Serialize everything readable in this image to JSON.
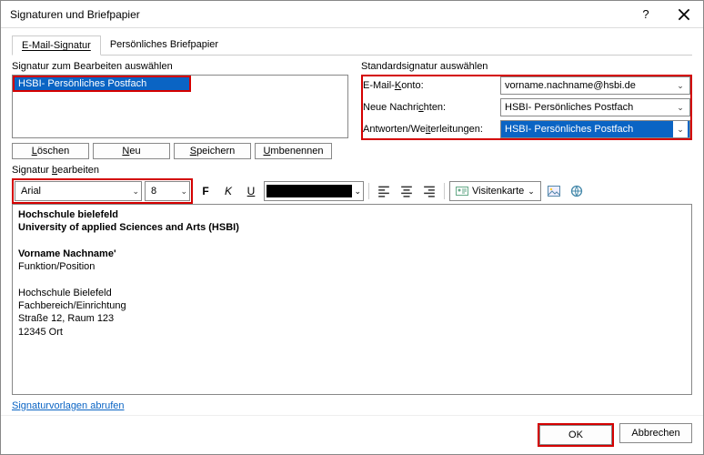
{
  "titlebar": {
    "title": "Signaturen und Briefpapier"
  },
  "tabs": {
    "t1": "E-Mail-Signatur",
    "t2": "Persönliches Briefpapier"
  },
  "left": {
    "label": "Signatur zum Bearbeiten auswählen",
    "item": "HSBI- Persönliches Postfach",
    "btn_delete": "Löschen",
    "btn_new": "Neu",
    "btn_save": "Speichern",
    "btn_rename": "Umbenennen"
  },
  "right": {
    "label": "Standardsignatur auswählen",
    "l_account": "E-Mail-Konto:",
    "v_account": "vorname.nachname@hsbi.de",
    "l_new": "Neue Nachrichten:",
    "v_new": "HSBI- Persönliches Postfach",
    "l_reply": "Antworten/Weiterleitungen:",
    "v_reply": "HSBI- Persönliches Postfach"
  },
  "editlabel": "Signatur bearbeiten",
  "toolbar": {
    "font": "Arial",
    "size": "8",
    "bold": "F",
    "italic": "K",
    "underline": "U",
    "bizcard": "Visitenkarte"
  },
  "editor": {
    "l1": "Hochschule bielefeld",
    "l2": "University of applied Sciences and Arts (HSBI)",
    "l3": "Vorname Nachname'",
    "l4": "Funktion/Position",
    "l5": "Hochschule Bielefeld",
    "l6": "Fachbereich/Einrichtung",
    "l7": "Straße 12, Raum 123",
    "l8": "12345 Ort"
  },
  "link": "Signaturvorlagen abrufen",
  "footer": {
    "ok": "OK",
    "cancel": "Abbrechen"
  }
}
